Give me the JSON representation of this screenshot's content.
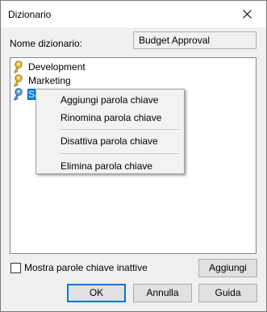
{
  "window": {
    "title": "Dizionario"
  },
  "form": {
    "name_label": "Nome dizionario:",
    "name_value": "Budget Approval"
  },
  "tree": {
    "items": [
      {
        "label": "Development",
        "icon": "key-icon",
        "icon_color": "#e0b441"
      },
      {
        "label": "Marketing",
        "icon": "key-icon",
        "icon_color": "#e0b441"
      },
      {
        "label": "Sa",
        "icon": "key-icon",
        "icon_color": "#5a8fd0",
        "selected": true
      }
    ]
  },
  "context_menu": {
    "items": [
      {
        "label": "Aggiungi parola chiave"
      },
      {
        "label": "Rinomina parola chiave"
      },
      {
        "label": "Disattiva parola chiave"
      },
      {
        "label": "Elimina parola chiave"
      }
    ]
  },
  "footer": {
    "checkbox_label": "Mostra parole chiave inattive",
    "add_button": "Aggiungi",
    "ok_button": "OK",
    "cancel_button": "Annulla",
    "help_button": "Guida"
  },
  "colors": {
    "selection": "#0078d7",
    "default_button_border": "#0078d7"
  }
}
